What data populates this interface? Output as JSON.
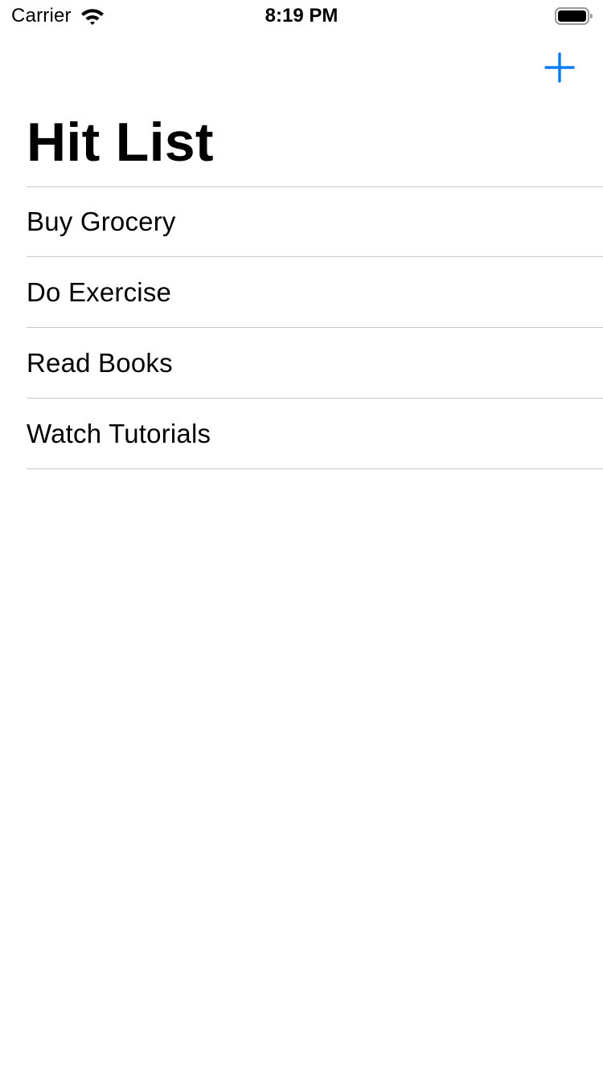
{
  "status_bar": {
    "carrier": "Carrier",
    "time": "8:19 PM",
    "wifi_icon": "wifi-icon",
    "battery_icon": "battery-full-icon"
  },
  "nav": {
    "add_icon": "plus-icon",
    "accent_color": "#007aff"
  },
  "title": "Hit List",
  "items": [
    {
      "label": "Buy Grocery"
    },
    {
      "label": "Do Exercise"
    },
    {
      "label": "Read Books"
    },
    {
      "label": "Watch Tutorials"
    }
  ],
  "colors": {
    "background": "#ffffff",
    "text": "#000000",
    "separator": "#c8c7cc"
  }
}
